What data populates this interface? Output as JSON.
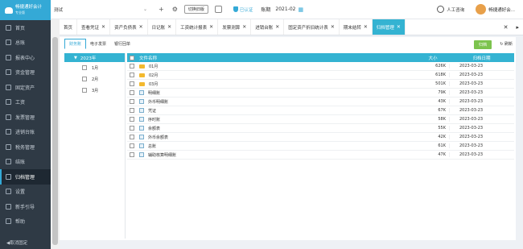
{
  "app": {
    "brand": "畅捷通好会计",
    "brand_sub": "专业版"
  },
  "sidebar": {
    "items": [
      {
        "label": "首页",
        "icon": "home-icon"
      },
      {
        "label": "总账",
        "icon": "ledger-icon"
      },
      {
        "label": "报表中心",
        "icon": "report-icon"
      },
      {
        "label": "资金管理",
        "icon": "fund-icon"
      },
      {
        "label": "固定资产",
        "icon": "asset-icon"
      },
      {
        "label": "工资",
        "icon": "salary-icon"
      },
      {
        "label": "发票管理",
        "icon": "invoice-icon"
      },
      {
        "label": "进销台账",
        "icon": "inventory-icon"
      },
      {
        "label": "税务管理",
        "icon": "tax-icon"
      },
      {
        "label": "结账",
        "icon": "close-books-icon"
      },
      {
        "label": "归档管理",
        "icon": "archive-icon",
        "active": true
      },
      {
        "label": "设置",
        "icon": "settings-icon"
      },
      {
        "label": "新手引导",
        "icon": "guide-icon"
      },
      {
        "label": "帮助",
        "icon": "help-icon"
      }
    ],
    "collapse_label": "◀取消固定"
  },
  "topbar": {
    "company": "测试",
    "add_icon": "+",
    "settings_icon": "⚙",
    "switch_label": "切换旧版",
    "verified_label": "已认证",
    "period_label": "账期",
    "period_value": "2021-02",
    "support_label": "人工咨询",
    "user_label": "畅捷通好会..."
  },
  "tabs": [
    {
      "label": "首页",
      "closable": false
    },
    {
      "label": "查看凭证",
      "closable": true
    },
    {
      "label": "资产负债表",
      "closable": true
    },
    {
      "label": "日记账",
      "closable": true
    },
    {
      "label": "工资统计报表",
      "closable": true
    },
    {
      "label": "发票测算",
      "closable": true
    },
    {
      "label": "进销台账",
      "closable": true
    },
    {
      "label": "固定资产折旧统计表",
      "closable": true
    },
    {
      "label": "期末结转",
      "closable": true
    },
    {
      "label": "归档管理",
      "closable": true,
      "active": true
    }
  ],
  "archive": {
    "subtabs": [
      "财务账",
      "电子发票",
      "银行回单"
    ],
    "active_subtab": 0,
    "filing_button": "归档",
    "refresh_label": "刷新",
    "tree_root": "2023年",
    "tree_months": [
      "1月",
      "2月",
      "3月"
    ],
    "columns": {
      "name": "文件名称",
      "size": "大小",
      "date": "归档日期"
    },
    "rows": [
      {
        "name": "01月",
        "type": "folder",
        "size": "626K",
        "date": "2023-03-23"
      },
      {
        "name": "02月",
        "type": "folder",
        "size": "618K",
        "date": "2023-03-23"
      },
      {
        "name": "03月",
        "type": "folder",
        "size": "501K",
        "date": "2023-03-23"
      },
      {
        "name": "明细账",
        "type": "file",
        "size": "79K",
        "date": "2023-03-23"
      },
      {
        "name": "外币明细账",
        "type": "file",
        "size": "43K",
        "date": "2023-03-23"
      },
      {
        "name": "凭证",
        "type": "file",
        "size": "67K",
        "date": "2023-03-23"
      },
      {
        "name": "序时账",
        "type": "file",
        "size": "58K",
        "date": "2023-03-23"
      },
      {
        "name": "余额表",
        "type": "file",
        "size": "55K",
        "date": "2023-03-23"
      },
      {
        "name": "外币余额表",
        "type": "file",
        "size": "42K",
        "date": "2023-03-23"
      },
      {
        "name": "总账",
        "type": "file",
        "size": "61K",
        "date": "2023-03-23"
      },
      {
        "name": "辅助核算明细账",
        "type": "file",
        "size": "47K",
        "date": "2023-03-23"
      }
    ]
  }
}
